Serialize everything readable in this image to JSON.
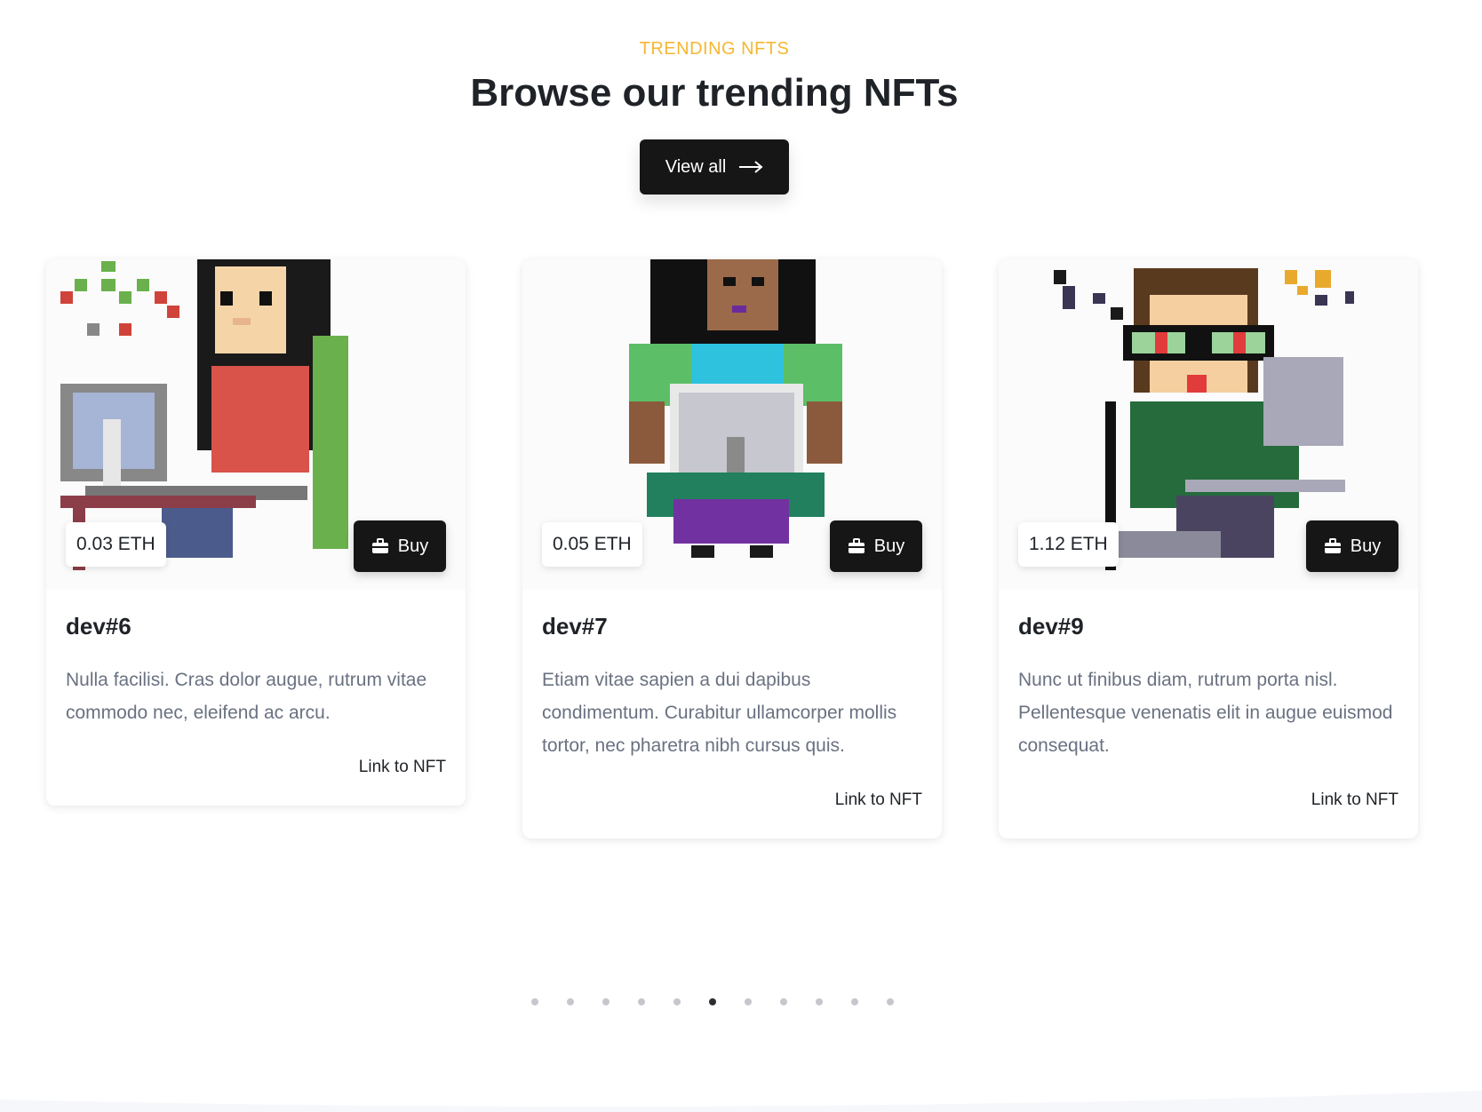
{
  "section": {
    "eyebrow": "TRENDING NFTS",
    "title": "Browse our trending NFTs",
    "view_all_label": "View all"
  },
  "cards": [
    {
      "name": "dev#6",
      "price": "0.03 ETH",
      "buy_label": "Buy",
      "description": "Nulla facilisi. Cras dolor augue, rutrum vitae commodo nec, eleifend ac arcu.",
      "link_label": "Link to NFT"
    },
    {
      "name": "dev#7",
      "price": "0.05 ETH",
      "buy_label": "Buy",
      "description": "Etiam vitae sapien a dui dapibus condimentum. Curabitur ullamcorper mollis tortor, nec pharetra nibh cursus quis.",
      "link_label": "Link to NFT"
    },
    {
      "name": "dev#9",
      "price": "1.12 ETH",
      "buy_label": "Buy",
      "description": "Nunc ut finibus diam, rutrum porta nisl. Pellentesque venenatis elit in augue euismod consequat.",
      "link_label": "Link to NFT"
    }
  ],
  "pagination": {
    "total": 11,
    "active_index": 5
  },
  "colors": {
    "accent": "#f5b731",
    "dark": "#161616",
    "muted_text": "#6a7181"
  },
  "icons": {
    "arrow": "arrow-right-icon",
    "buy": "briefcase-icon"
  }
}
